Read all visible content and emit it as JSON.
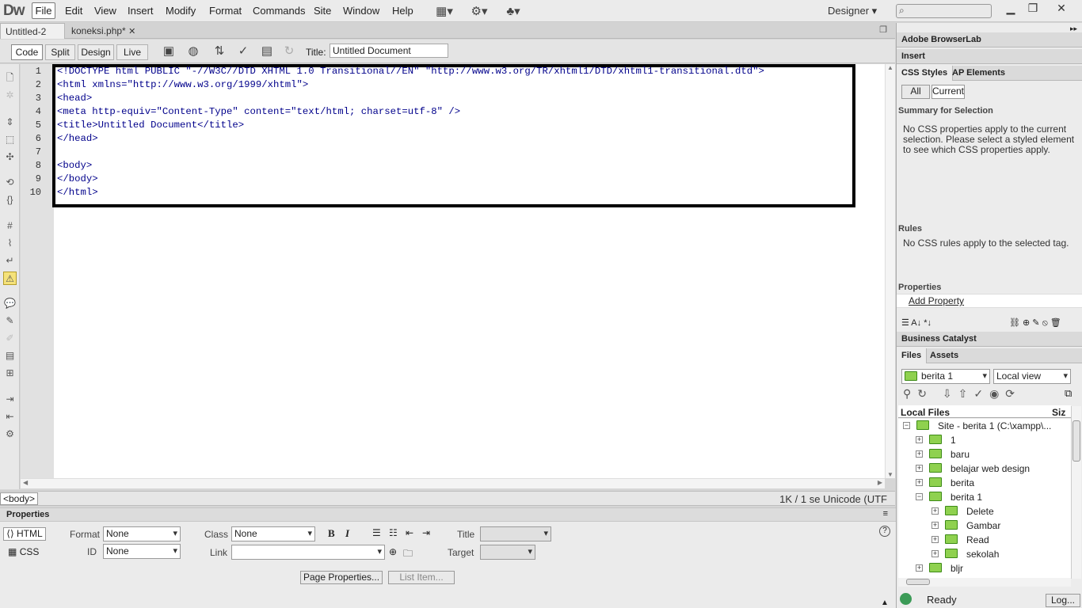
{
  "app": {
    "logo": "Dw",
    "workspace": "Designer"
  },
  "menu": [
    "File",
    "Edit",
    "View",
    "Insert",
    "Modify",
    "Format",
    "Commands",
    "Site",
    "Window",
    "Help"
  ],
  "tabs": [
    {
      "label": "Untitled-2",
      "active": true
    },
    {
      "label": "koneksi.php*",
      "active": false
    }
  ],
  "doc_toolbar": {
    "views": [
      "Code",
      "Split",
      "Design",
      "Live"
    ],
    "title_label": "Title:",
    "title_value": "Untitled Document"
  },
  "code": {
    "line_numbers": [
      "1",
      "2",
      "3",
      "4",
      "5",
      "6",
      "7",
      "8",
      "9",
      "10"
    ],
    "lines": [
      "<!DOCTYPE html PUBLIC \"-//W3C//DTD XHTML 1.0 Transitional//EN\" \"http://www.w3.org/TR/xhtml1/DTD/xhtml1-transitional.dtd\">",
      "<html xmlns=\"http://www.w3.org/1999/xhtml\">",
      "<head>",
      "<meta http-equiv=\"Content-Type\" content=\"text/html; charset=utf-8\" />",
      "<title>Untitled Document</title>",
      "</head>",
      "",
      "<body>",
      "</body>",
      "</html>"
    ]
  },
  "status": {
    "tag": "<body>",
    "info": "1K / 1 se  Unicode (UTF"
  },
  "properties": {
    "title": "Properties",
    "html_btn": "HTML",
    "css_btn": "CSS",
    "format_label": "Format",
    "format_value": "None",
    "class_label": "Class",
    "class_value": "None",
    "id_label": "ID",
    "id_value": "None",
    "link_label": "Link",
    "title_label": "Title",
    "target_label": "Target",
    "bold": "B",
    "italic": "I",
    "page_properties": "Page Properties...",
    "list_item": "List Item..."
  },
  "right_panel": {
    "browserlab": "Adobe BrowserLab",
    "insert": "Insert",
    "css_tab": "CSS Styles",
    "ap_tab": "AP Elements",
    "all_btn": "All",
    "current_btn": "Current",
    "summary_title": "Summary for Selection",
    "summary_text": "No CSS properties apply to the current selection.  Please select a styled element to see which CSS properties apply.",
    "rules_title": "Rules",
    "rules_text": "No CSS rules apply to the selected tag.",
    "properties_title": "Properties",
    "add_property": "Add Property",
    "business_catalyst": "Business Catalyst",
    "files_tab": "Files",
    "assets_tab": "Assets",
    "site_select": "berita 1",
    "view_select": "Local view",
    "local_files": "Local Files",
    "size_col": "Siz",
    "tree": [
      {
        "label": "Site - berita 1 (C:\\xampp\\...",
        "level": 0,
        "expander": "−"
      },
      {
        "label": "1",
        "level": 1,
        "expander": "+"
      },
      {
        "label": "baru",
        "level": 1,
        "expander": "+"
      },
      {
        "label": "belajar web design",
        "level": 1,
        "expander": "+"
      },
      {
        "label": "berita",
        "level": 1,
        "expander": "+"
      },
      {
        "label": "berita 1",
        "level": 1,
        "expander": "−"
      },
      {
        "label": "Delete",
        "level": 2,
        "expander": "+"
      },
      {
        "label": "Gambar",
        "level": 2,
        "expander": "+"
      },
      {
        "label": "Read",
        "level": 2,
        "expander": "+"
      },
      {
        "label": "sekolah",
        "level": 2,
        "expander": "+"
      },
      {
        "label": "bljr",
        "level": 1,
        "expander": "+"
      }
    ],
    "ready": "Ready",
    "log_btn": "Log..."
  }
}
